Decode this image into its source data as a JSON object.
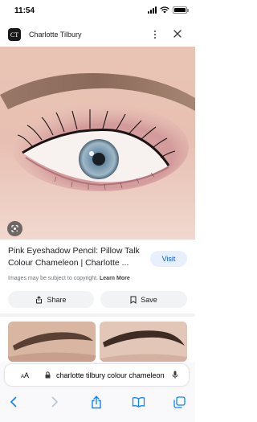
{
  "status_bar": {
    "time": "11:54",
    "battery_level": 0.85
  },
  "site": {
    "favicon_label": "CT",
    "name": "Charlotte Tilbury"
  },
  "result": {
    "title": "Pink Eyeshadow Pencil: Pillow Talk Colour Chameleon | Charlotte ...",
    "visit_label": "Visit",
    "copyright_text": "Images may be subject to copyright.",
    "learn_more_label": "Learn More"
  },
  "actions": {
    "share_label": "Share",
    "save_label": "Save"
  },
  "browser": {
    "aa_label_small": "A",
    "aa_label": "A",
    "url": "charlotte tilbury colour chameleon"
  },
  "colors": {
    "accent": "#0b57d0",
    "visit_bg": "#e8f0fe",
    "toolbar_icon": "#0a84ff",
    "chip_bg": "#f1f3f4"
  },
  "icons": {
    "favicon": "charlotte-tilbury-logo",
    "more": "more-vert-icon",
    "close": "close-icon",
    "lens": "google-lens-icon",
    "share": "share-icon",
    "save": "bookmark-icon",
    "lock": "lock-icon",
    "mic": "microphone-icon",
    "back": "chevron-left-icon",
    "forward": "chevron-right-icon",
    "share_sheet": "share-sheet-icon",
    "bookmarks": "book-icon",
    "tabs": "tabs-icon"
  }
}
